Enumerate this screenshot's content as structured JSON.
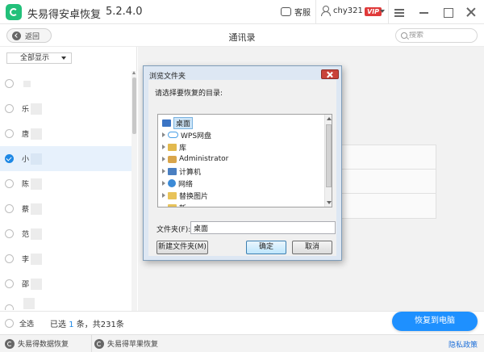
{
  "titlebar": {
    "app_name": "失易得安卓恢复",
    "version": "5.2.4.0",
    "service_label": "客服",
    "username": "chy321",
    "vip_label": "VIP"
  },
  "nav": {
    "back_label": "返回",
    "page_title": "通讯录",
    "search_placeholder": "搜索"
  },
  "filter": {
    "selected": "全部显示"
  },
  "contacts": [
    {
      "name": "",
      "checked": false
    },
    {
      "name": "乐",
      "checked": false
    },
    {
      "name": "唐",
      "checked": false
    },
    {
      "name": "小",
      "checked": true
    },
    {
      "name": "陈",
      "checked": false
    },
    {
      "name": "蔡",
      "checked": false
    },
    {
      "name": "范",
      "checked": false
    },
    {
      "name": "李",
      "checked": false
    },
    {
      "name": "邵",
      "checked": false
    },
    {
      "name": "",
      "checked": false
    }
  ],
  "bottom": {
    "select_all_label": "全选",
    "count_prefix": "已选",
    "count_selected": "1",
    "count_mid": "条，共",
    "count_total": "231",
    "count_suffix": "条",
    "recover_label": "恢复到电脑"
  },
  "footer": {
    "data_recovery_label": "失易得数据恢复",
    "iphone_recovery_label": "失易得苹果恢复",
    "privacy_label": "隐私政策"
  },
  "dialog": {
    "title": "浏览文件夹",
    "prompt": "请选择要恢复的目录:",
    "tree_items": [
      {
        "label": "桌面",
        "icon": "desktop-icon",
        "selected": true,
        "expandable": false
      },
      {
        "label": "WPS网盘",
        "icon": "cloud-icon",
        "selected": false,
        "expandable": true
      },
      {
        "label": "库",
        "icon": "library-icon",
        "selected": false,
        "expandable": true
      },
      {
        "label": "Administrator",
        "icon": "user-folder-icon",
        "selected": false,
        "expandable": true
      },
      {
        "label": "计算机",
        "icon": "computer-icon",
        "selected": false,
        "expandable": true
      },
      {
        "label": "网络",
        "icon": "network-icon",
        "selected": false,
        "expandable": true
      },
      {
        "label": "替换图片",
        "icon": "folder-icon",
        "selected": false,
        "expandable": true
      },
      {
        "label": "新",
        "icon": "folder-icon",
        "selected": false,
        "expandable": false
      }
    ],
    "folder_label": "文件夹(F):",
    "folder_value": "桌面",
    "new_folder_label": "新建文件夹(M)",
    "ok_label": "确定",
    "cancel_label": "取消"
  },
  "colors": {
    "accent": "#1e90ff",
    "brand": "#22c07a",
    "vip": "#e03a3a"
  }
}
